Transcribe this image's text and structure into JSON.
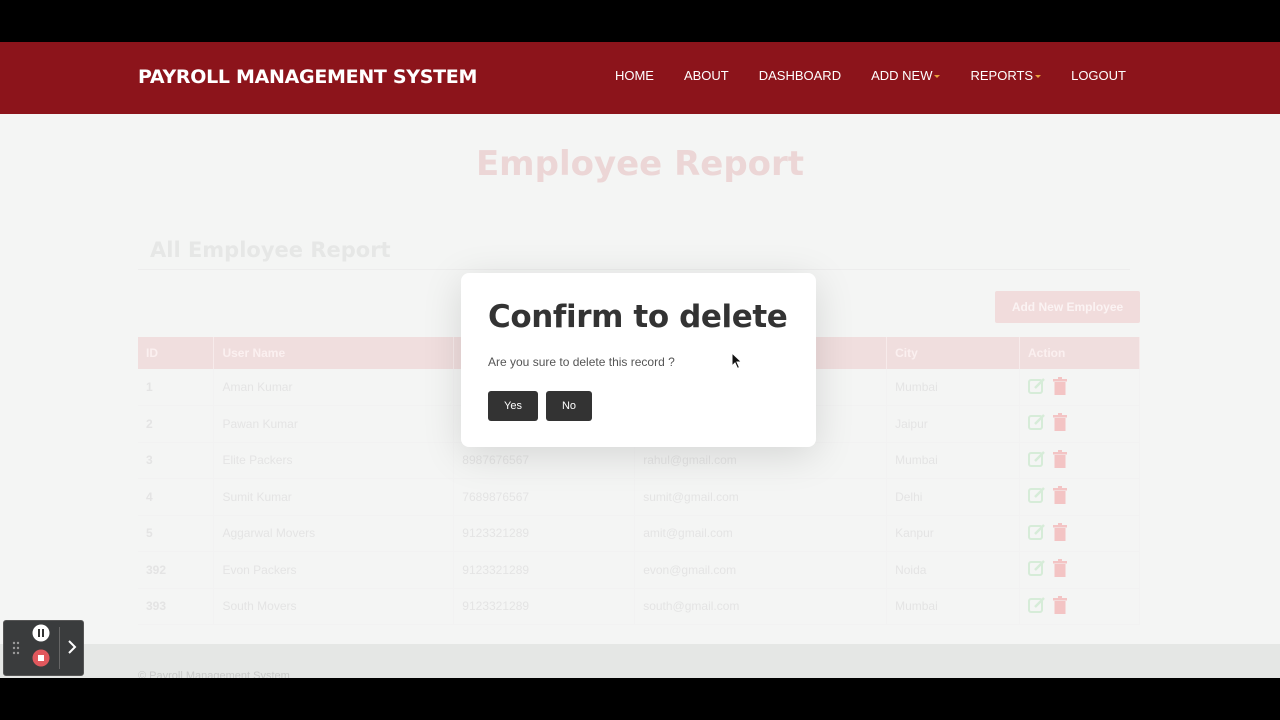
{
  "brand": "PAYROLL MANAGEMENT SYSTEM",
  "nav": [
    {
      "label": "HOME",
      "dropdown": false
    },
    {
      "label": "ABOUT",
      "dropdown": false
    },
    {
      "label": "DASHBOARD",
      "dropdown": false
    },
    {
      "label": "ADD NEW",
      "dropdown": true
    },
    {
      "label": "REPORTS",
      "dropdown": true
    },
    {
      "label": "LOGOUT",
      "dropdown": false
    }
  ],
  "page_title": "Employee Report",
  "section_title": "All Employee Report",
  "add_button": "Add New Employee",
  "table": {
    "columns": [
      "ID",
      "User Name",
      "",
      "",
      "City",
      "Action"
    ],
    "rows": [
      [
        "1",
        "Aman Kumar",
        "",
        "",
        "Mumbai"
      ],
      [
        "2",
        "Pawan Kumar",
        "",
        "",
        "Jaipur"
      ],
      [
        "3",
        "Elite Packers",
        "8987676567",
        "rahul@gmail.com",
        "Mumbai"
      ],
      [
        "4",
        "Sumit Kumar",
        "7689876567",
        "sumit@gmail.com",
        "Delhi"
      ],
      [
        "5",
        "Aggarwal Movers",
        "9123321289",
        "amit@gmail.com",
        "Kanpur"
      ],
      [
        "392",
        "Evon Packers",
        "9123321289",
        "evon@gmail.com",
        "Noida"
      ],
      [
        "393",
        "South Movers",
        "9123321289",
        "south@gmail.com",
        "Mumbai"
      ]
    ]
  },
  "footer": "© Payroll Management System",
  "modal": {
    "title": "Confirm to delete",
    "message": "Are you sure to delete this record ?",
    "yes": "Yes",
    "no": "No"
  },
  "icons": {
    "edit": "edit-icon",
    "delete": "trash-icon",
    "pause": "pause-icon",
    "stop": "stop-icon",
    "expand": "chevron-right-icon",
    "drag": "drag-handle-icon"
  },
  "colors": {
    "navbar": "#8c141b",
    "caret": "#e8a33c",
    "modal_button": "#333333"
  }
}
